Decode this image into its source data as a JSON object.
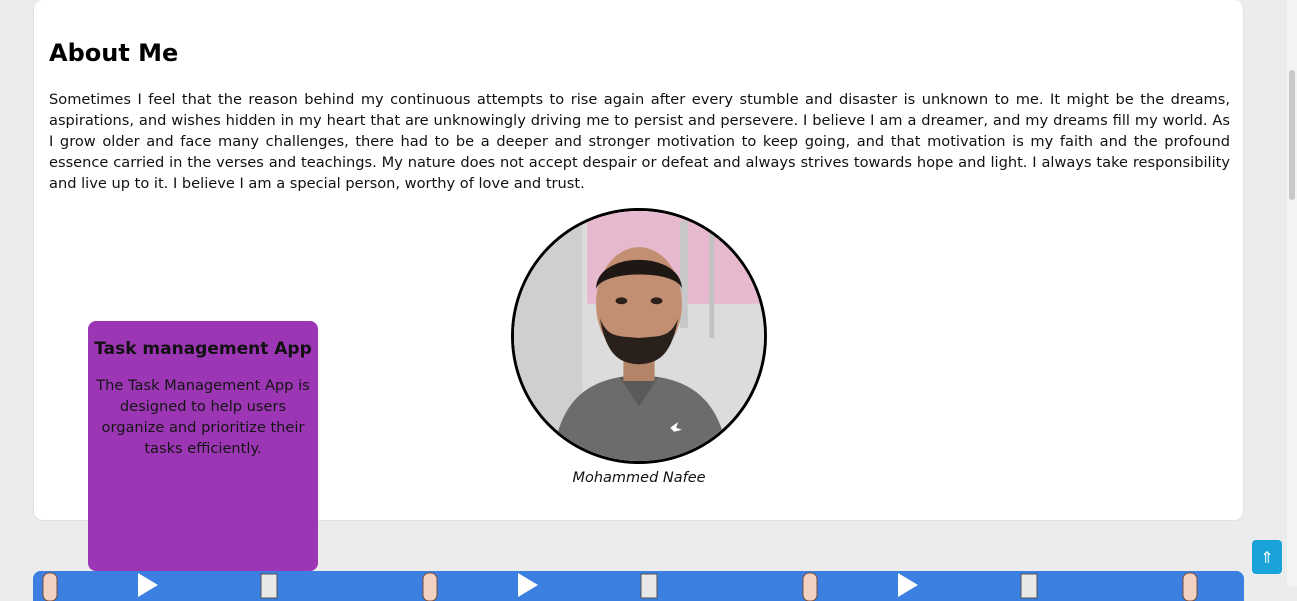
{
  "about": {
    "title": "About Me",
    "paragraph": "Sometimes I feel that the reason behind my continuous attempts to rise again after every stumble and disaster is unknown to me. It might be the dreams, aspirations, and wishes hidden in my heart that are unknowingly driving me to persist and persevere. I believe I am a dreamer, and my dreams fill my world. As I grow older and face many challenges, there had to be a deeper and stronger motivation to keep going, and that motivation is my faith and the profound essence carried in the verses and teachings. My nature does not accept despair or defeat and always strives towards hope and light. I always take responsibility and live up to it. I believe I am a special person, worthy of love and trust.",
    "photo_caption": "Mohammed Nafee"
  },
  "project_card": {
    "title": "Task management App",
    "description": "The Task Management App is designed to help users organize and prioritize their tasks efficiently."
  },
  "scroll_top": {
    "icon": "double-arrow-up-icon",
    "glyph": "⇑"
  },
  "colors": {
    "page_bg": "#ececec",
    "card_bg": "#ffffff",
    "project_card_bg": "#9c36b5",
    "banner_bg": "#3b7fe0",
    "scroll_top_bg": "#1aa3d9"
  }
}
